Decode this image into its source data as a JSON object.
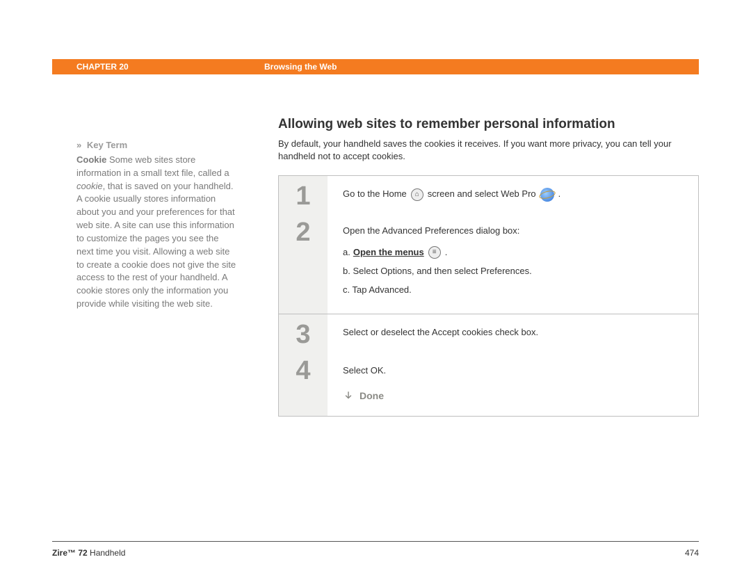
{
  "header": {
    "chapter": "CHAPTER 20",
    "section": "Browsing the Web"
  },
  "sidebar": {
    "keyterm_label": "Key Term",
    "keyterm_bold": "Cookie",
    "keyterm_text_1": " Some web sites store information in a small text file, called a ",
    "keyterm_italic": "cookie",
    "keyterm_text_2": ", that is saved on your handheld. A cookie usually stores information about you and your preferences for that web site. A site can use this information to customize the pages you see the next time you visit. Allowing a web site to create a cookie does not give the site access to the rest of your handheld. A cookie stores only the information you provide while visiting the web site."
  },
  "main": {
    "heading": "Allowing web sites to remember personal information",
    "intro": "By default, your handheld saves the cookies it receives. If you want more privacy, you can tell your handheld not to accept cookies.",
    "steps": {
      "s1_a": "Go to the Home",
      "s1_b": "screen and select Web Pro",
      "s1_c": ".",
      "s2_intro": "Open the Advanced Preferences dialog box:",
      "s2_a_prefix": "a.",
      "s2_a_link": "Open the menus",
      "s2_a_suffix": ".",
      "s2_b": "b.  Select Options, and then select Preferences.",
      "s2_c": "c.  Tap Advanced.",
      "s3": "Select or deselect the Accept cookies check box.",
      "s4": "Select OK.",
      "done": "Done"
    }
  },
  "footer": {
    "product_bold": "Zire™ 72",
    "product_rest": " Handheld",
    "page": "474"
  }
}
